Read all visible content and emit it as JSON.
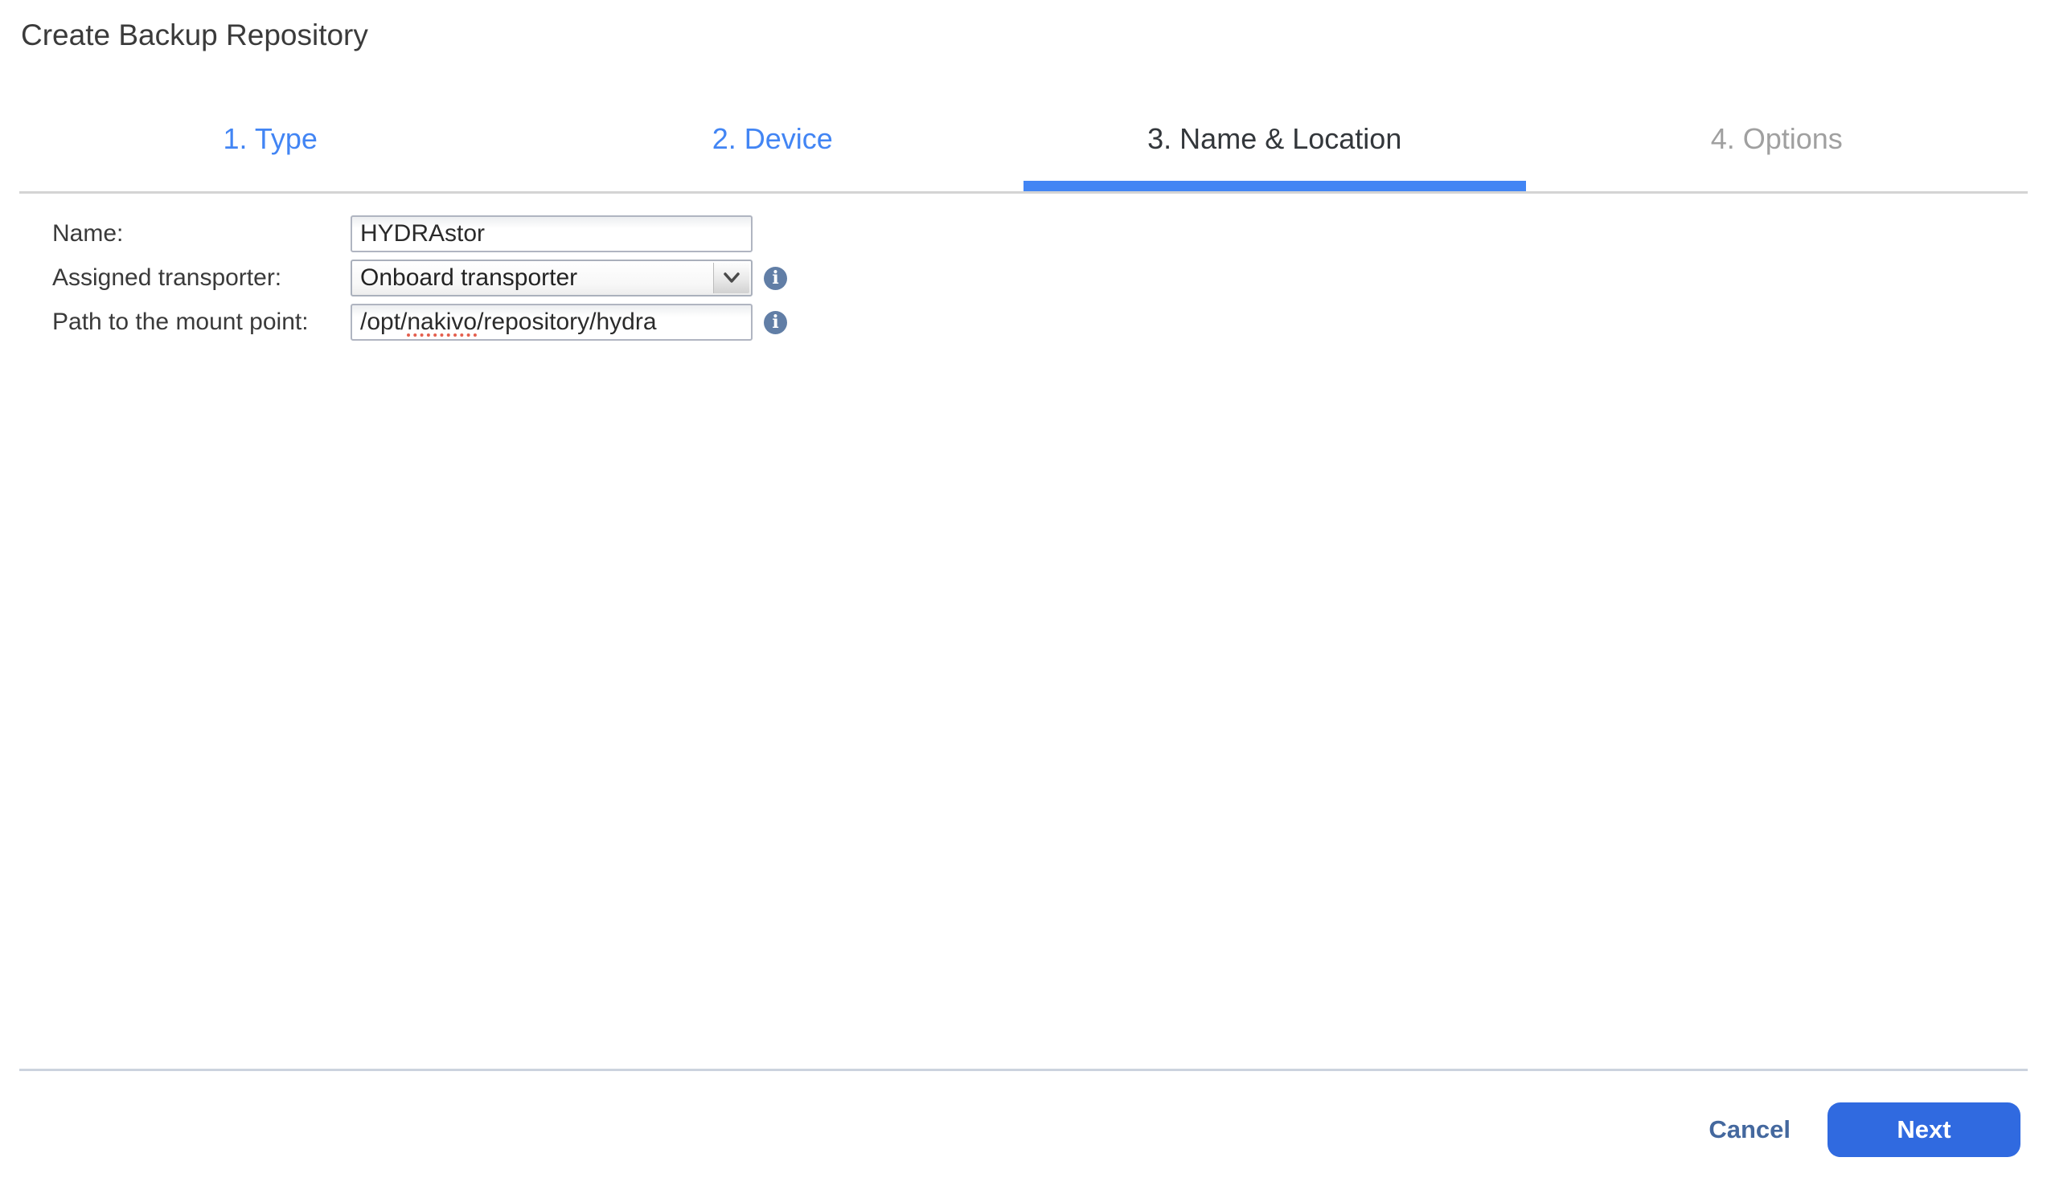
{
  "window": {
    "title": "Create Backup Repository"
  },
  "wizard": {
    "steps": [
      {
        "label": "1. Type",
        "state": "done"
      },
      {
        "label": "2. Device",
        "state": "done"
      },
      {
        "label": "3. Name & Location",
        "state": "active"
      },
      {
        "label": "4. Options",
        "state": "next"
      }
    ]
  },
  "form": {
    "name": {
      "label": "Name:",
      "value": "HYDRAstor"
    },
    "transporter": {
      "label": "Assigned transporter:",
      "value": "Onboard transporter",
      "info_icon": "info-icon"
    },
    "path": {
      "label": "Path to the mount point:",
      "value": "/opt/nakivo/repository/hydra",
      "segments": {
        "prefix": "/opt/",
        "misspelled": "nakivo",
        "suffix": "/repository/hydra"
      },
      "info_icon": "info-icon"
    }
  },
  "footer": {
    "cancel_label": "Cancel",
    "next_label": "Next"
  },
  "colors": {
    "accent_blue": "#4285f4",
    "active_step_text": "#33373b",
    "inactive_step_text": "#a0a0a0",
    "next_button_bg": "#306ae0",
    "cancel_text": "#44689e",
    "info_icon_bg": "#617ea6",
    "spellcheck_underline": "#e4604f",
    "divider": "#ccd3de",
    "field_border": "#b0b5c1"
  }
}
